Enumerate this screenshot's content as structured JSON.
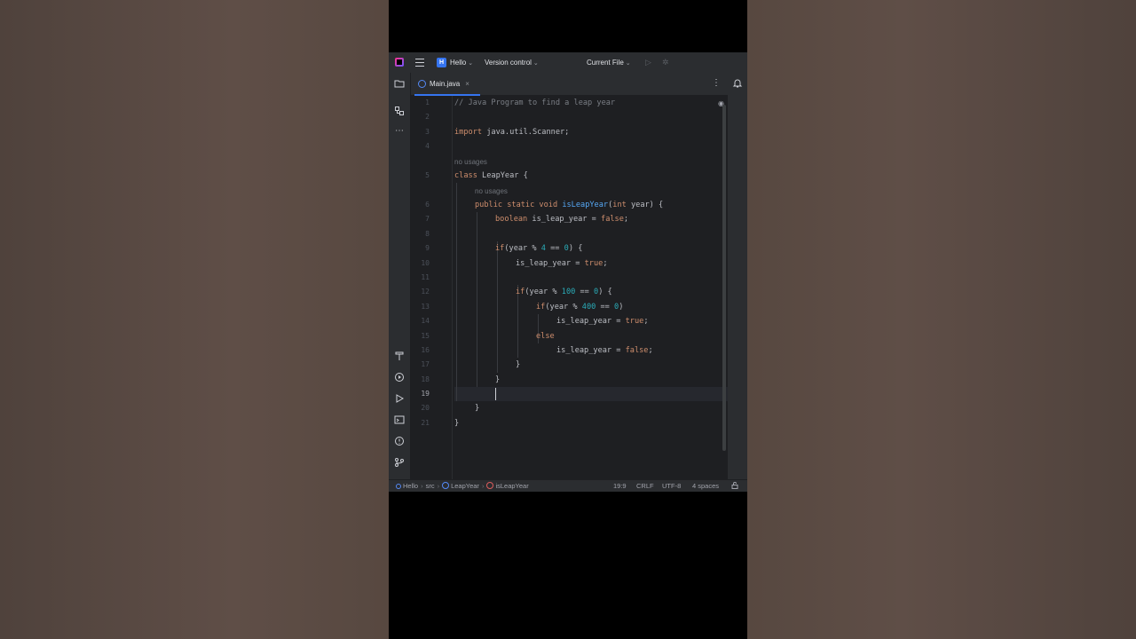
{
  "titlebar": {
    "project": "Hello",
    "project_badge": "H",
    "version_control": "Version control",
    "current_file": "Current File"
  },
  "tab": {
    "label": "Main.java",
    "close": "×"
  },
  "hints": {
    "usages": "no usages"
  },
  "status": {
    "breadcrumb_project": "Hello",
    "breadcrumb_src": "src",
    "breadcrumb_class": "LeapYear",
    "breadcrumb_method": "isLeapYear",
    "position": "19:9",
    "line_sep": "CRLF",
    "encoding": "UTF-8",
    "indent": "4 spaces"
  },
  "code_lines": [
    {
      "n": "1"
    },
    {
      "n": "2"
    },
    {
      "n": "3"
    },
    {
      "n": "4"
    },
    {
      "n": "5"
    },
    {
      "n": "6"
    },
    {
      "n": "7"
    },
    {
      "n": "8"
    },
    {
      "n": "9"
    },
    {
      "n": "10"
    },
    {
      "n": "11"
    },
    {
      "n": "12"
    },
    {
      "n": "13"
    },
    {
      "n": "14"
    },
    {
      "n": "15"
    },
    {
      "n": "16"
    },
    {
      "n": "17"
    },
    {
      "n": "18"
    },
    {
      "n": "19"
    },
    {
      "n": "20"
    },
    {
      "n": "21"
    }
  ],
  "code": {
    "l1": "// Java Program to find a leap year",
    "l3_kw": "import",
    "l3_rest": " java.util.Scanner;",
    "l5_kw": "class",
    "l5_rest": " LeapYear {",
    "l6_kw": "public static void",
    "l6_fn": "isLeapYear",
    "l6_p1": "(",
    "l6_kw2": "int",
    "l6_p2": " year) {",
    "l7_kw": "boolean",
    "l7_mid": " is_leap_year = ",
    "l7_kw2": "false",
    "l7_end": ";",
    "l9_kw": "if",
    "l9_a": "(year % ",
    "l9_n1": "4",
    "l9_b": " == ",
    "l9_n2": "0",
    "l9_c": ") {",
    "l10_a": "is_leap_year = ",
    "l10_kw": "true",
    "l10_end": ";",
    "l12_kw": "if",
    "l12_a": "(year % ",
    "l12_n1": "100",
    "l12_b": " == ",
    "l12_n2": "0",
    "l12_c": ") {",
    "l13_kw": "if",
    "l13_a": "(year % ",
    "l13_n1": "400",
    "l13_b": " == ",
    "l13_n2": "0",
    "l13_c": ")",
    "l14_a": "is_leap_year = ",
    "l14_kw": "true",
    "l14_end": ";",
    "l15_kw": "else",
    "l16_a": "is_leap_year = ",
    "l16_kw": "false",
    "l16_end": ";",
    "brace": "}"
  },
  "active_line": "19"
}
